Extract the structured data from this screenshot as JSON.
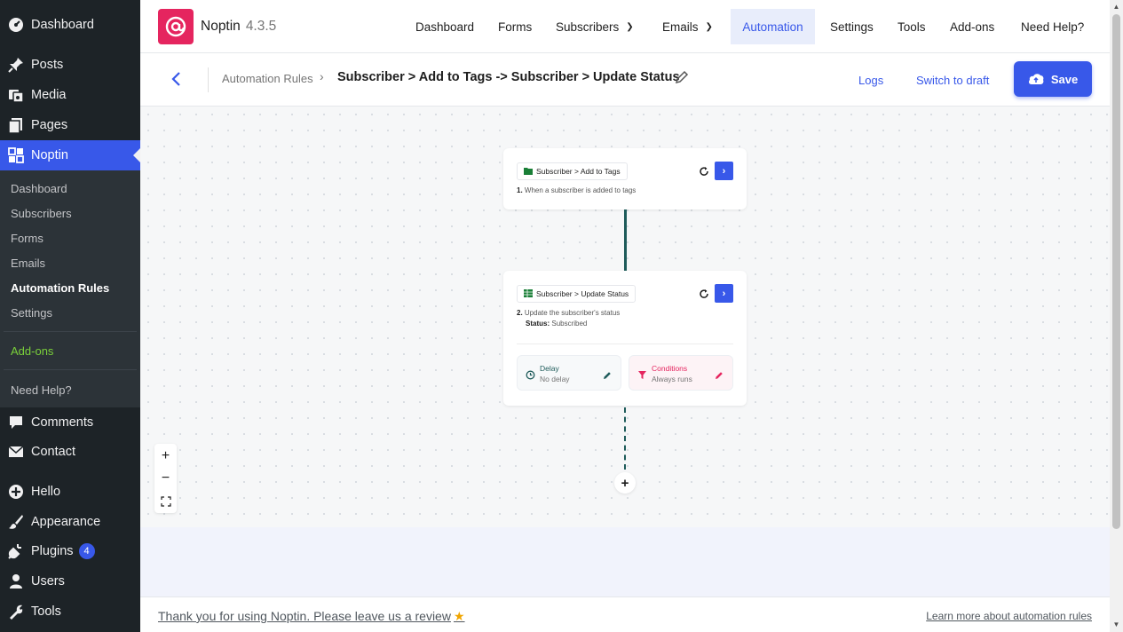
{
  "sidebar": {
    "dashboard": "Dashboard",
    "posts": "Posts",
    "media": "Media",
    "pages": "Pages",
    "noptin": "Noptin",
    "sub": {
      "dashboard": "Dashboard",
      "subscribers": "Subscribers",
      "forms": "Forms",
      "emails": "Emails",
      "automation_rules": "Automation Rules",
      "settings": "Settings",
      "addons": "Add-ons",
      "need_help": "Need Help?"
    },
    "comments": "Comments",
    "contact": "Contact",
    "hello": "Hello",
    "appearance": "Appearance",
    "plugins": "Plugins",
    "plugins_badge": "4",
    "users": "Users",
    "tools": "Tools"
  },
  "topbar": {
    "brand": "Noptin",
    "version": "4.3.5",
    "nav": {
      "dashboard": "Dashboard",
      "forms": "Forms",
      "subscribers": "Subscribers",
      "emails": "Emails",
      "automation": "Automation",
      "settings": "Settings",
      "tools": "Tools",
      "addons": "Add-ons",
      "need_help": "Need Help?"
    }
  },
  "header": {
    "breadcrumb_parent": "Automation Rules",
    "title": "Subscriber > Add to Tags -> Subscriber > Update Status",
    "logs": "Logs",
    "switch_to_draft": "Switch to draft",
    "save": "Save"
  },
  "workflow": {
    "trigger": {
      "label": "Subscriber > Add to Tags",
      "step_num": "1.",
      "desc": "When a subscriber is added to tags"
    },
    "action": {
      "label": "Subscriber > Update Status",
      "step_num": "2.",
      "desc": "Update the subscriber's status",
      "status_key": "Status:",
      "status_value": "Subscribed",
      "delay_title": "Delay",
      "delay_value": "No delay",
      "conditions_title": "Conditions",
      "conditions_value": "Always runs"
    }
  },
  "footer": {
    "thanks": "Thank you for using Noptin. Please leave us a review",
    "learn_more": "Learn more about automation rules"
  },
  "colors": {
    "accent": "#3858e9",
    "brand": "#e5255f",
    "connector": "#1e5b5a",
    "addons_green": "#7ad03a"
  }
}
